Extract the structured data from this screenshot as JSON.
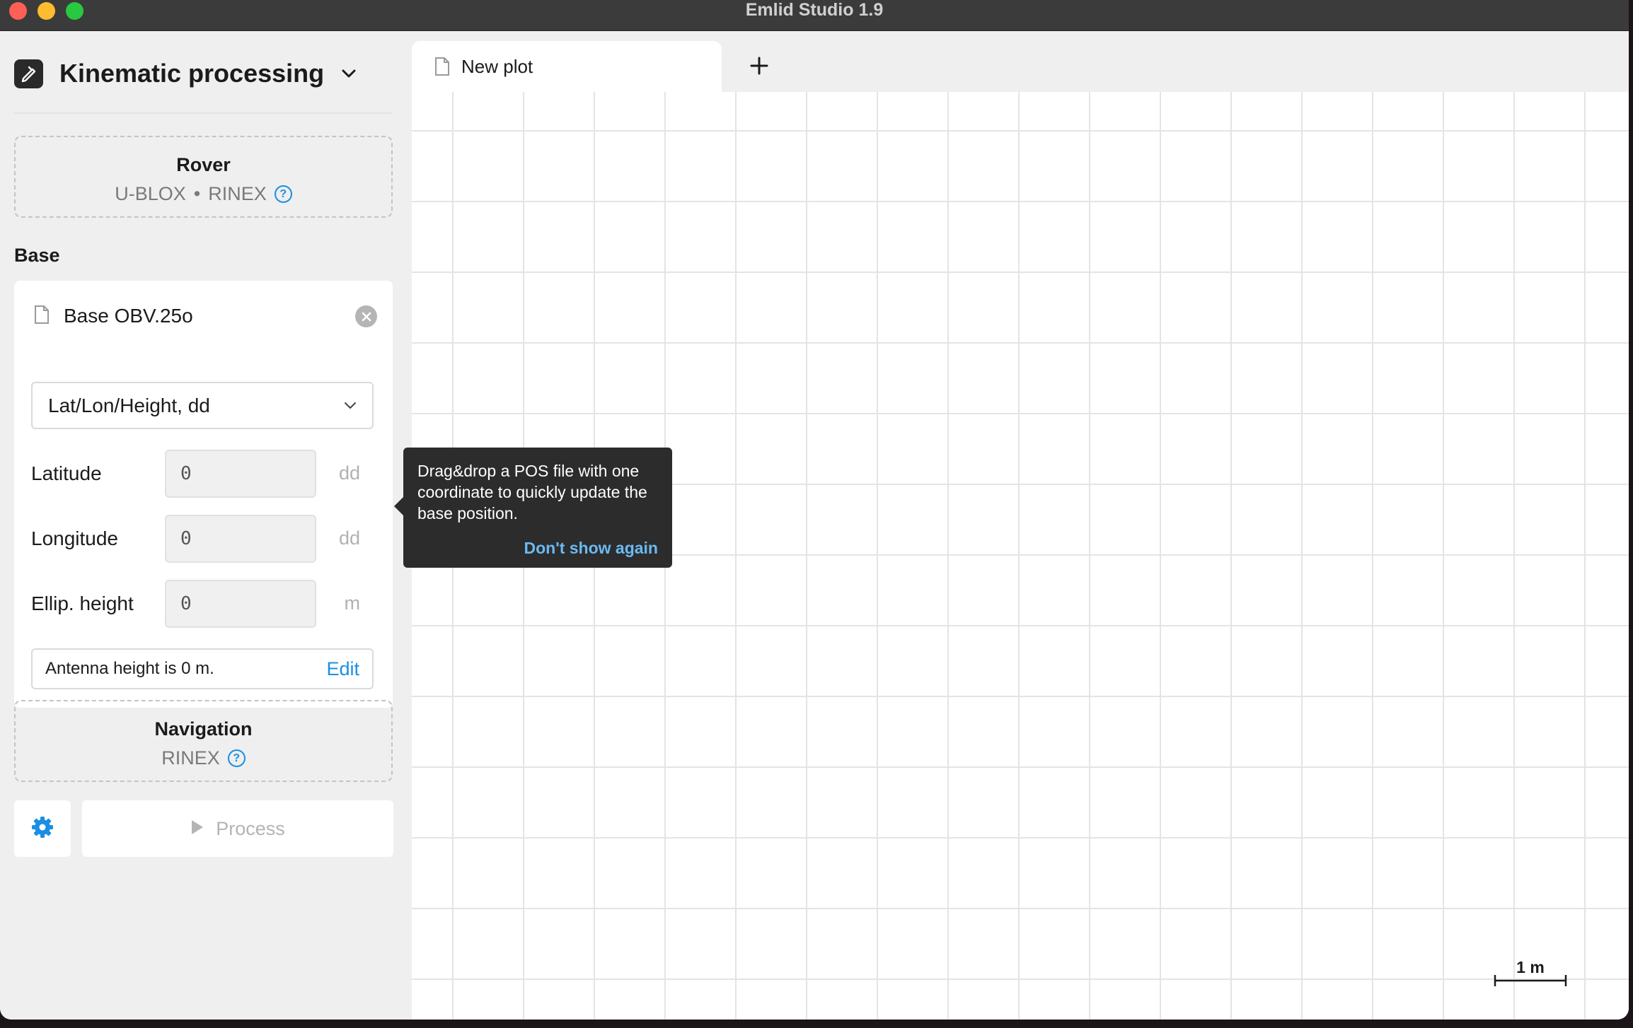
{
  "window": {
    "title": "Emlid Studio 1.9"
  },
  "sidebar": {
    "mode": {
      "title": "Kinematic processing"
    },
    "rover": {
      "title": "Rover",
      "receiver": "U-BLOX",
      "separator": "•",
      "format": "RINEX",
      "help_glyph": "?"
    },
    "base": {
      "section_label": "Base",
      "file_name": "Base OBV.25o",
      "coordinate_format": "Lat/Lon/Height, dd",
      "fields": [
        {
          "label": "Latitude",
          "value": "0",
          "unit": "dd"
        },
        {
          "label": "Longitude",
          "value": "0",
          "unit": "dd"
        },
        {
          "label": "Ellip. height",
          "value": "0",
          "unit": "m"
        }
      ],
      "antenna_text": "Antenna height is 0 m.",
      "antenna_edit": "Edit"
    },
    "navigation": {
      "title": "Navigation",
      "format": "RINEX",
      "help_glyph": "?"
    },
    "actions": {
      "process_label": "Process"
    }
  },
  "tabs": {
    "items": [
      {
        "label": "New plot"
      }
    ],
    "add_glyph": "+"
  },
  "plot": {
    "scale_label": "1 m"
  },
  "tooltip": {
    "text": "Drag&drop a POS file with one coordinate to quickly update the base position.",
    "action": "Don't show again"
  },
  "colors": {
    "accent": "#1a8fe3",
    "tooltip_bg": "#2c2c2c",
    "tooltip_link": "#6bb9f2",
    "sidebar_bg": "#efefef",
    "titlebar_bg": "#3b3b3b"
  },
  "icons": {
    "mode": "pen-icon",
    "file": "file-icon",
    "clear": "close-circle-icon",
    "settings": "gear-icon",
    "process": "play-icon",
    "help": "question-circle-icon",
    "dropdown": "chevron-down-icon",
    "add": "plus-icon"
  }
}
